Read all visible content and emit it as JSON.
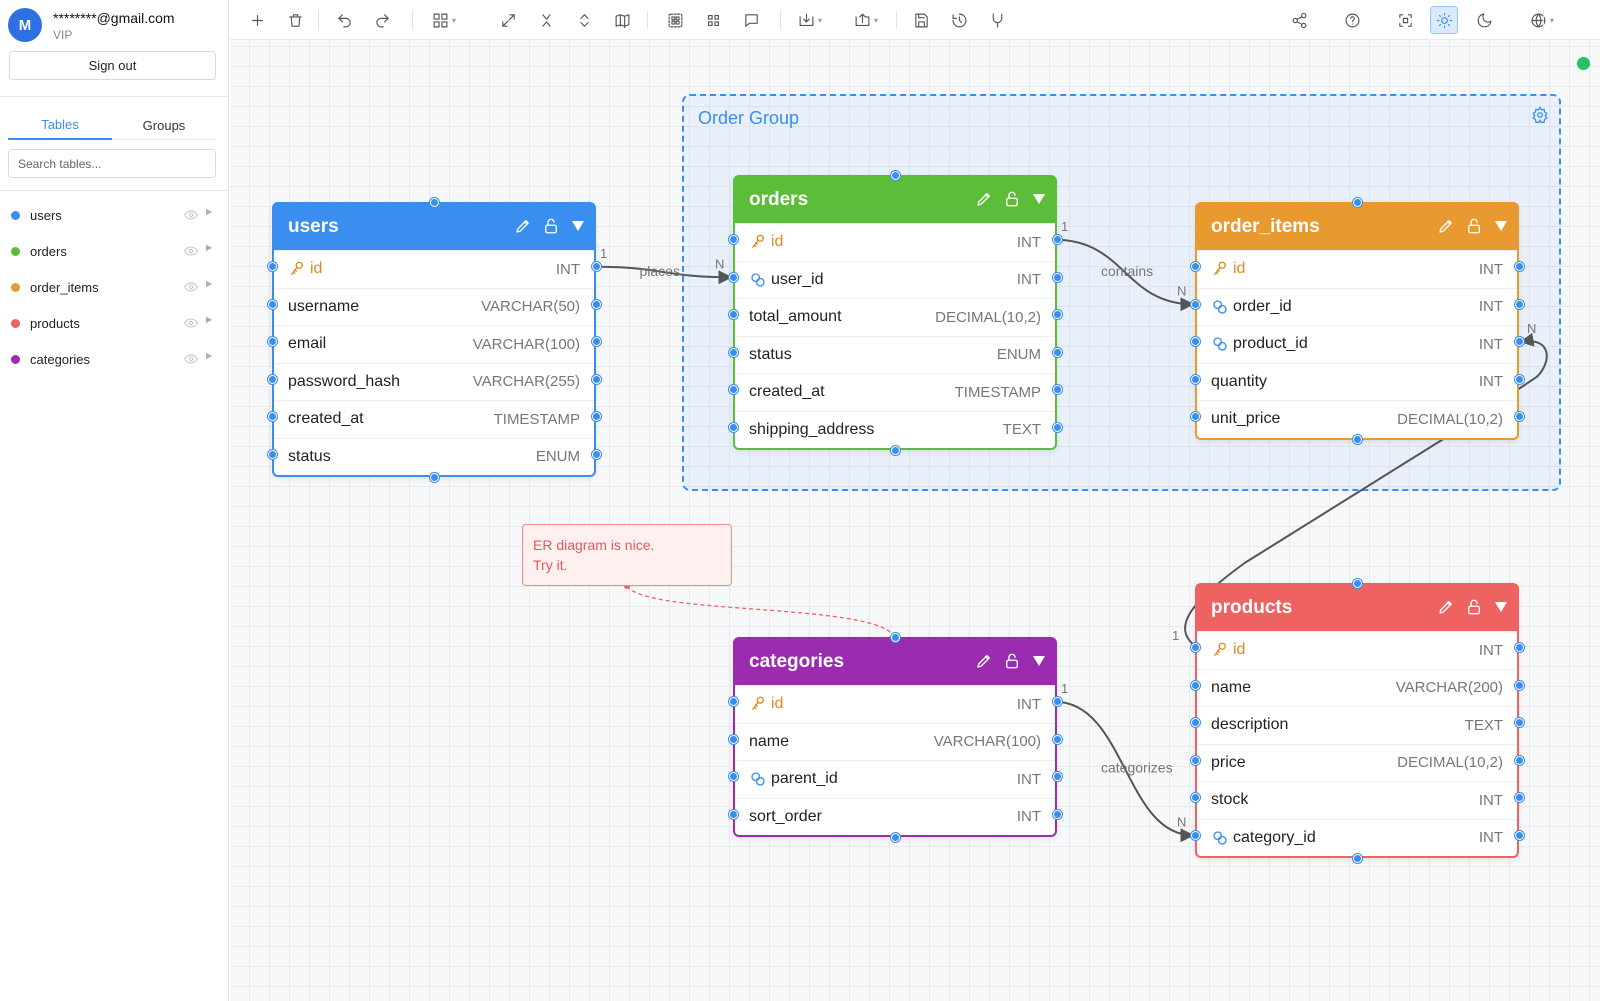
{
  "user": {
    "avatar_letter": "M",
    "email": "********@gmail.com",
    "plan": "VIP",
    "sign_out": "Sign out"
  },
  "sidebar": {
    "tabs": [
      {
        "label": "Tables",
        "active": true
      },
      {
        "label": "Groups",
        "active": false
      }
    ],
    "search_placeholder": "Search tables...",
    "tables": [
      {
        "name": "users",
        "color": "#3a8ef0"
      },
      {
        "name": "orders",
        "color": "#5bbd3a"
      },
      {
        "name": "order_items",
        "color": "#e89a30"
      },
      {
        "name": "products",
        "color": "#ef6262"
      },
      {
        "name": "categories",
        "color": "#9b2cb0"
      }
    ]
  },
  "toolbar": {
    "left": [
      "add-icon",
      "delete-icon",
      "undo-icon",
      "redo-icon",
      "layout-icon",
      "expand-icon",
      "collapse-vertical-icon",
      "expand-vertical-icon",
      "map-icon",
      "group-select-icon",
      "grid-icon",
      "comment-icon",
      "import-icon",
      "export-icon",
      "save-icon",
      "history-icon",
      "branch-icon"
    ],
    "right": [
      "share-icon",
      "help-icon",
      "fit-view-icon",
      "light-mode-icon",
      "dark-mode-icon",
      "language-icon"
    ],
    "active": "light-mode-icon"
  },
  "group": {
    "title": "Order Group",
    "color": "#3a8ef0"
  },
  "note": {
    "text": "ER diagram is nice.\nTry it."
  },
  "tables": [
    {
      "id": "users",
      "name": "users",
      "color": "#3a8ef0",
      "fields": [
        {
          "name": "id",
          "type": "INT",
          "key": "pk"
        },
        {
          "name": "username",
          "type": "VARCHAR(50)",
          "key": ""
        },
        {
          "name": "email",
          "type": "VARCHAR(100)",
          "key": ""
        },
        {
          "name": "password_hash",
          "type": "VARCHAR(255)",
          "key": ""
        },
        {
          "name": "created_at",
          "type": "TIMESTAMP",
          "key": ""
        },
        {
          "name": "status",
          "type": "ENUM",
          "key": ""
        }
      ]
    },
    {
      "id": "orders",
      "name": "orders",
      "color": "#5bbd3a",
      "fields": [
        {
          "name": "id",
          "type": "INT",
          "key": "pk"
        },
        {
          "name": "user_id",
          "type": "INT",
          "key": "fk"
        },
        {
          "name": "total_amount",
          "type": "DECIMAL(10,2)",
          "key": ""
        },
        {
          "name": "status",
          "type": "ENUM",
          "key": ""
        },
        {
          "name": "created_at",
          "type": "TIMESTAMP",
          "key": ""
        },
        {
          "name": "shipping_address",
          "type": "TEXT",
          "key": ""
        }
      ]
    },
    {
      "id": "order_items",
      "name": "order_items",
      "color": "#e89a30",
      "fields": [
        {
          "name": "id",
          "type": "INT",
          "key": "pk"
        },
        {
          "name": "order_id",
          "type": "INT",
          "key": "fk"
        },
        {
          "name": "product_id",
          "type": "INT",
          "key": "fk"
        },
        {
          "name": "quantity",
          "type": "INT",
          "key": ""
        },
        {
          "name": "unit_price",
          "type": "DECIMAL(10,2)",
          "key": ""
        }
      ]
    },
    {
      "id": "categories",
      "name": "categories",
      "color": "#9b2cb0",
      "fields": [
        {
          "name": "id",
          "type": "INT",
          "key": "pk"
        },
        {
          "name": "name",
          "type": "VARCHAR(100)",
          "key": ""
        },
        {
          "name": "parent_id",
          "type": "INT",
          "key": "fk"
        },
        {
          "name": "sort_order",
          "type": "INT",
          "key": ""
        }
      ]
    },
    {
      "id": "products",
      "name": "products",
      "color": "#ef6262",
      "fields": [
        {
          "name": "id",
          "type": "INT",
          "key": "pk"
        },
        {
          "name": "name",
          "type": "VARCHAR(200)",
          "key": ""
        },
        {
          "name": "description",
          "type": "TEXT",
          "key": ""
        },
        {
          "name": "price",
          "type": "DECIMAL(10,2)",
          "key": ""
        },
        {
          "name": "stock",
          "type": "INT",
          "key": ""
        },
        {
          "name": "category_id",
          "type": "INT",
          "key": "fk"
        }
      ]
    }
  ],
  "relations": [
    {
      "from": "users.id",
      "to": "orders.user_id",
      "label": "places",
      "from_card": "1",
      "to_card": "N"
    },
    {
      "from": "orders.id",
      "to": "order_items.order_id",
      "label": "contains",
      "from_card": "1",
      "to_card": "N"
    },
    {
      "from": "products.id",
      "to": "order_items.product_id",
      "label": "",
      "from_card": "1",
      "to_card": "N"
    },
    {
      "from": "categories.id",
      "to": "products.category_id",
      "label": "categorizes",
      "from_card": "1",
      "to_card": "N"
    }
  ]
}
